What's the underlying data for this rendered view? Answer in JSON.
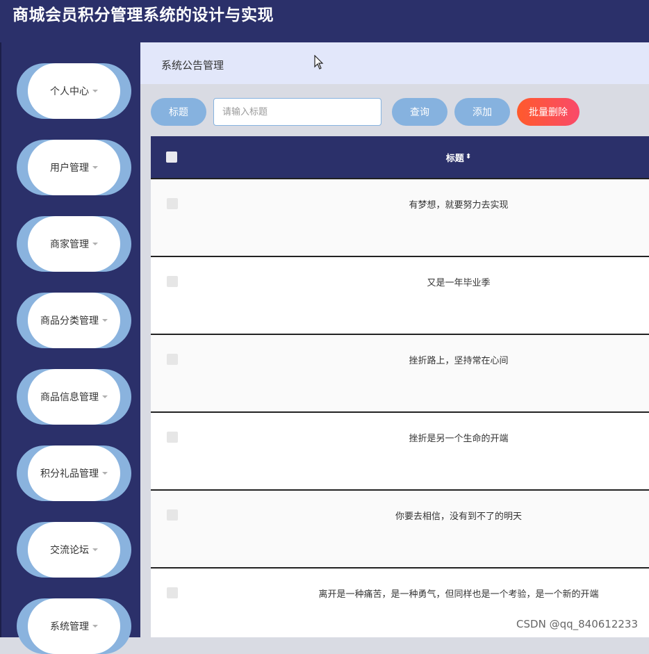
{
  "app": {
    "title": "商城会员积分管理系统的设计与实现"
  },
  "sidebar": {
    "items": [
      {
        "label": "个人中心"
      },
      {
        "label": "用户管理"
      },
      {
        "label": "商家管理"
      },
      {
        "label": "商品分类管理"
      },
      {
        "label": "商品信息管理"
      },
      {
        "label": "积分礼品管理"
      },
      {
        "label": "交流论坛"
      },
      {
        "label": "系统管理"
      }
    ]
  },
  "breadcrumb": {
    "label": "系统公告管理"
  },
  "toolbar": {
    "title_label": "标题",
    "search_placeholder": "请输入标题",
    "query_label": "查询",
    "add_label": "添加",
    "batch_delete_label": "批量删除"
  },
  "table": {
    "header_title": "标题",
    "rows": [
      {
        "title": "有梦想，就要努力去实现"
      },
      {
        "title": "又是一年毕业季"
      },
      {
        "title": "挫折路上，坚持常在心间"
      },
      {
        "title": "挫折是另一个生命的开端"
      },
      {
        "title": "你要去相信，没有到不了的明天"
      },
      {
        "title": "离开是一种痛苦，是一种勇气，但同样也是一个考验，是一个新的开端"
      }
    ]
  },
  "watermark": "CSDN @qq_840612233",
  "colors": {
    "nav_bg": "#2b306a",
    "accent_blue": "#86b2df",
    "danger": "#ff5a2c",
    "breadcrumb_bg": "#e2e7fa"
  }
}
